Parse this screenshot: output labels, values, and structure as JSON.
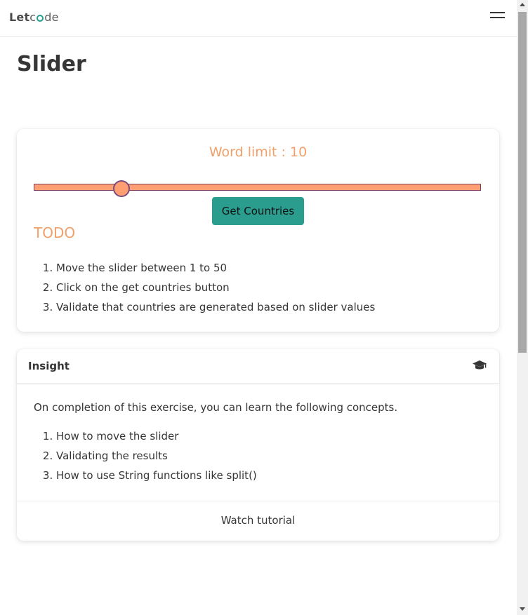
{
  "navbar": {
    "logo_let": "Let",
    "logo_c": "c",
    "logo_de": "de"
  },
  "page": {
    "title": "Slider"
  },
  "slider_card": {
    "word_limit_label": "Word limit : 10",
    "slider": {
      "min": 1,
      "max": 50,
      "value": 10
    },
    "button_label": "Get Countries",
    "todo_heading": "TODO",
    "todo_items": [
      "Move the slider between 1 to 50",
      "Click on the get countries button",
      "Validate that countries are generated based on slider values"
    ]
  },
  "insight_card": {
    "title": "Insight",
    "icon": "graduation-cap-icon",
    "intro": "On completion of this exercise, you can learn the following concepts.",
    "items": [
      "How to move the slider",
      "Validating the results",
      "How to use String functions like split()"
    ],
    "footer_link": "Watch tutorial"
  },
  "colors": {
    "accent_orange": "#ff9e73",
    "heading_orange": "#f0a06a",
    "button_teal": "#2a9d8f"
  }
}
